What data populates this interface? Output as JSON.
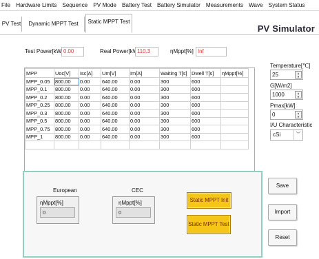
{
  "menu": [
    "File",
    "Hardware Limits",
    "Sequence",
    "PV Mode",
    "Battery Test",
    "Battery Simulator",
    "Measurements",
    "Wave",
    "System Status"
  ],
  "tabs": [
    "PV Test",
    "Dynamic MPPT Test",
    "Static MPPT Test"
  ],
  "app_title": "PV Simulator",
  "readouts": {
    "test_power_label": "Test Power[kW]",
    "test_power_value": "0.00",
    "real_power_label": "Real Power[kW]",
    "real_power_value": "110.3",
    "eff_label": "ηMppt[%]",
    "eff_value": "Inf"
  },
  "table": {
    "headers": [
      "MPP",
      "Uoc[V]",
      "Isc[A]",
      "Um[V]",
      "Im[A]",
      "Waiting T[s]",
      "Dwell T[s]",
      "ηMppt[%]"
    ],
    "rows": [
      [
        "MPP_0.05",
        "800.00",
        "0.00",
        "640.00",
        "0.00",
        "300",
        "600",
        ""
      ],
      [
        "MPP_0.1",
        "800.00",
        "0.00",
        "640.00",
        "0.00",
        "300",
        "600",
        ""
      ],
      [
        "MPP_0.2",
        "800.00",
        "0.00",
        "640.00",
        "0.00",
        "300",
        "600",
        ""
      ],
      [
        "MPP_0.25",
        "800.00",
        "0.00",
        "640.00",
        "0.00",
        "300",
        "600",
        ""
      ],
      [
        "MPP_0.3",
        "800.00",
        "0.00",
        "640.00",
        "0.00",
        "300",
        "600",
        ""
      ],
      [
        "MPP_0.5",
        "800.00",
        "0.00",
        "640.00",
        "0.00",
        "300",
        "600",
        ""
      ],
      [
        "MPP_0.75",
        "800.00",
        "0.00",
        "640.00",
        "0.00",
        "300",
        "600",
        ""
      ],
      [
        "MPP_1",
        "800.00",
        "0.00",
        "640.00",
        "0.00",
        "300",
        "600",
        ""
      ]
    ]
  },
  "params": {
    "temperature_label": "Temperature[℃]",
    "temperature_value": "25",
    "irradiance_label": "G[W/m2]",
    "irradiance_value": "1000",
    "pmax_label": "Pmax[kW]",
    "pmax_value": "0",
    "iu_label": "I/U Characteristic",
    "iu_value": "cSi"
  },
  "efficiency": {
    "european_title": "European",
    "european_label": "ηMppt[%]",
    "european_value": "0",
    "cec_title": "CEC",
    "cec_label": "ηMppt[%]",
    "cec_value": "0"
  },
  "buttons": {
    "static_init": "Static MPPT Init",
    "static_test": "Static MPPT Test",
    "save": "Save",
    "import": "Import",
    "reset": "Reset"
  },
  "colors": {
    "value_red": "#e03030",
    "button_yellow": "#f5c518",
    "frame_teal": "#8fd0c3"
  }
}
